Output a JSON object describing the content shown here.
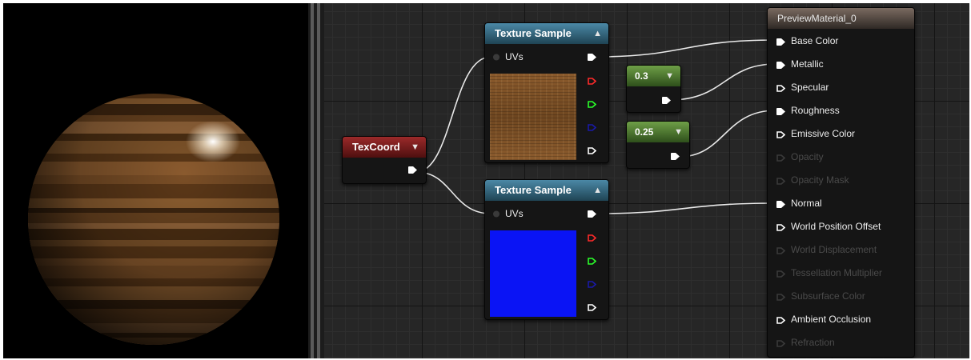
{
  "viewport": {
    "preview": "wooden sphere material preview"
  },
  "nodes": {
    "texcoord": {
      "title": "TexCoord"
    },
    "texture_sample_1": {
      "title": "Texture Sample",
      "input": "UVs",
      "swatch": "wood-grain"
    },
    "texture_sample_2": {
      "title": "Texture Sample",
      "input": "UVs",
      "swatch": "normal-map",
      "swatch_color": "#0a14f5"
    },
    "const_metallic": {
      "value": "0.3"
    },
    "const_roughness": {
      "value": "0.25"
    },
    "material": {
      "title": "PreviewMaterial_0",
      "pins": [
        {
          "label": "Base Color",
          "connected": true,
          "enabled": true
        },
        {
          "label": "Metallic",
          "connected": true,
          "enabled": true
        },
        {
          "label": "Specular",
          "connected": false,
          "enabled": true
        },
        {
          "label": "Roughness",
          "connected": true,
          "enabled": true
        },
        {
          "label": "Emissive Color",
          "connected": false,
          "enabled": true
        },
        {
          "label": "Opacity",
          "connected": false,
          "enabled": false
        },
        {
          "label": "Opacity Mask",
          "connected": false,
          "enabled": false
        },
        {
          "label": "Normal",
          "connected": true,
          "enabled": true
        },
        {
          "label": "World Position Offset",
          "connected": false,
          "enabled": true
        },
        {
          "label": "World Displacement",
          "connected": false,
          "enabled": false
        },
        {
          "label": "Tessellation Multiplier",
          "connected": false,
          "enabled": false
        },
        {
          "label": "Subsurface Color",
          "connected": false,
          "enabled": false
        },
        {
          "label": "Ambient Occlusion",
          "connected": false,
          "enabled": true
        },
        {
          "label": "Refraction",
          "connected": false,
          "enabled": false
        }
      ]
    }
  },
  "colors": {
    "wire": "#e8e8e8",
    "pin_r": "#ff2a2a",
    "pin_g": "#2aff2a",
    "pin_b": "#1a1aa8",
    "pin_white": "#ffffff"
  }
}
